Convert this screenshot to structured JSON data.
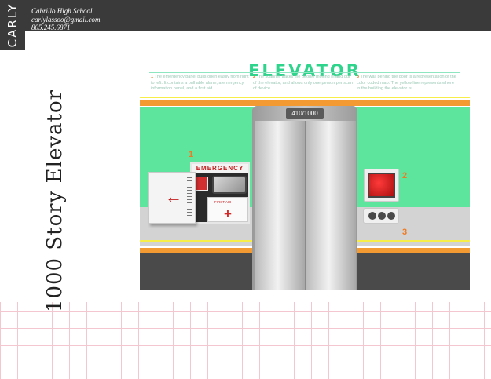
{
  "header": {
    "tab_label": "CARLY",
    "school": "Cabrillo High School",
    "email": "carlylassoo@gmail.com",
    "phone": "805.245.6871"
  },
  "project_title": "1000 Story Elevator",
  "poster": {
    "title": "ELEVATOR",
    "captions": [
      {
        "num": "1",
        "text": "The emergency panel pulls open easily from right to left. It contains a pull able alarm, a emergency information panel, and a first aid."
      },
      {
        "num": "2",
        "text": "The scanner tracks the people moving in and out of the elevator, and allows only one person per scan of device."
      },
      {
        "num": "3",
        "text": "The wall behind the door is a representation of the color coded map. The yellow line represents where in the building the elevator is."
      }
    ],
    "floor_counter": "410/1000",
    "emergency_label": "EMERGENCY",
    "first_aid_label": "FIRST AID",
    "callout_1": "1",
    "callout_2": "2",
    "callout_3": "3"
  },
  "colors": {
    "header_bg": "#3a3a3a",
    "accent_green": "#2fd48c",
    "wall_green": "#5de59e",
    "stripe_orange": "#f39a33",
    "stripe_yellow": "#f7ee4a",
    "alarm_red": "#c41d1d",
    "grid_pink": "#f4c6cf"
  },
  "icons": {
    "arrow": "left-arrow-icon",
    "cross": "first-aid-cross-icon"
  }
}
